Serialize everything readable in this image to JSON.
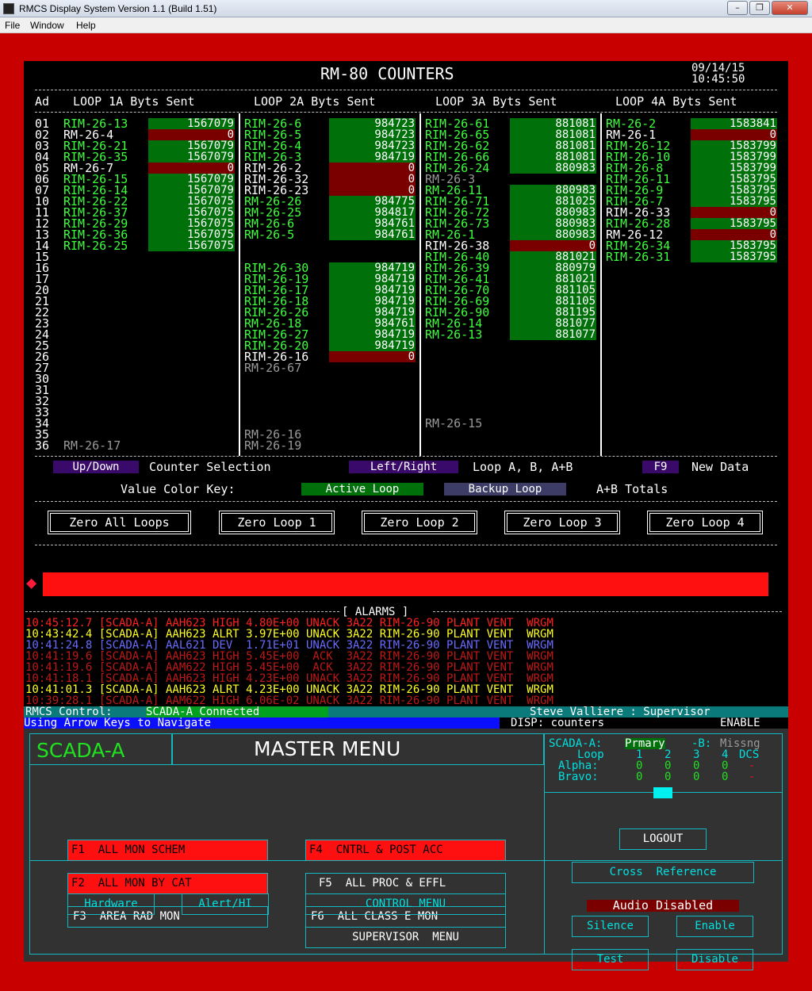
{
  "window": {
    "title": "RMCS Display System    Version 1.1    (Build 1.51)",
    "min_label": "–",
    "max_label": "❐",
    "close_label": "✕"
  },
  "menubar": {
    "items": [
      "File",
      "Window",
      "Help"
    ]
  },
  "header": {
    "title": "RM-80 COUNTERS",
    "date": "09/14/15",
    "time": "10:45:50"
  },
  "columns": {
    "addr_header": "Ad",
    "loop_headers": [
      "LOOP 1A Byts Sent",
      "LOOP 2A Byts Sent",
      "LOOP 3A Byts Sent",
      "LOOP 4A Byts Sent"
    ]
  },
  "addresses": [
    "01",
    "02",
    "03",
    "04",
    "05",
    "06",
    "07",
    "10",
    "11",
    "12",
    "13",
    "14",
    "15",
    "16",
    "17",
    "20",
    "21",
    "22",
    "23",
    "24",
    "25",
    "26",
    "27",
    "30",
    "31",
    "32",
    "33",
    "34",
    "35",
    "36"
  ],
  "loops": [
    {
      "rows": [
        {
          "name": "RIM-26-13",
          "value": "1567079",
          "status": "active"
        },
        {
          "name": "RM-26-4",
          "value": "0",
          "status": "zero"
        },
        {
          "name": "RIM-26-21",
          "value": "1567079",
          "status": "active"
        },
        {
          "name": "RIM-26-35",
          "value": "1567079",
          "status": "active"
        },
        {
          "name": "RM-26-7",
          "value": "0",
          "status": "zero"
        },
        {
          "name": "RIM-26-15",
          "value": "1567079",
          "status": "active"
        },
        {
          "name": "RIM-26-14",
          "value": "1567079",
          "status": "active"
        },
        {
          "name": "RIM-26-22",
          "value": "1567075",
          "status": "active"
        },
        {
          "name": "RIM-26-37",
          "value": "1567075",
          "status": "active"
        },
        {
          "name": "RIM-26-29",
          "value": "1567075",
          "status": "active"
        },
        {
          "name": "RIM-26-36",
          "value": "1567075",
          "status": "active"
        },
        {
          "name": "RIM-26-25",
          "value": "1567075",
          "status": "active"
        },
        null,
        null,
        null,
        null,
        null,
        null,
        null,
        null,
        null,
        null,
        null,
        null,
        null,
        null,
        null,
        null,
        null,
        {
          "name": "RM-26-17",
          "value": "",
          "status": "missing"
        }
      ]
    },
    {
      "rows": [
        {
          "name": "RIM-26-6",
          "value": "984723",
          "status": "active"
        },
        {
          "name": "RIM-26-5",
          "value": "984723",
          "status": "active"
        },
        {
          "name": "RIM-26-4",
          "value": "984723",
          "status": "active"
        },
        {
          "name": "RIM-26-3",
          "value": "984719",
          "status": "active"
        },
        {
          "name": "RIM-26-2",
          "value": "0",
          "status": "zero"
        },
        {
          "name": "RIM-26-32",
          "value": "0",
          "status": "zero"
        },
        {
          "name": "RIM-26-23",
          "value": "0",
          "status": "zero"
        },
        {
          "name": "RM-26-26",
          "value": "984775",
          "status": "active"
        },
        {
          "name": "RM-26-25",
          "value": "984817",
          "status": "active"
        },
        {
          "name": "RM-26-6",
          "value": "984761",
          "status": "active"
        },
        {
          "name": "RM-26-5",
          "value": "984761",
          "status": "active"
        },
        null,
        null,
        {
          "name": "RIM-26-30",
          "value": "984719",
          "status": "active"
        },
        {
          "name": "RIM-26-19",
          "value": "984719",
          "status": "active"
        },
        {
          "name": "RIM-26-17",
          "value": "984719",
          "status": "active"
        },
        {
          "name": "RIM-26-18",
          "value": "984719",
          "status": "active"
        },
        {
          "name": "RIM-26-26",
          "value": "984719",
          "status": "active"
        },
        {
          "name": "RM-26-18",
          "value": "984761",
          "status": "active"
        },
        {
          "name": "RIM-26-27",
          "value": "984719",
          "status": "active"
        },
        {
          "name": "RIM-26-20",
          "value": "984719",
          "status": "active"
        },
        {
          "name": "RIM-26-16",
          "value": "0",
          "status": "zero"
        },
        {
          "name": "RM-26-67",
          "value": "",
          "status": "missing"
        },
        null,
        null,
        null,
        null,
        null,
        {
          "name": "RM-26-16",
          "value": "",
          "status": "missing"
        },
        {
          "name": "RM-26-19",
          "value": "",
          "status": "missing"
        }
      ]
    },
    {
      "rows": [
        {
          "name": "RIM-26-61",
          "value": "881081",
          "status": "active"
        },
        {
          "name": "RIM-26-65",
          "value": "881081",
          "status": "active"
        },
        {
          "name": "RIM-26-62",
          "value": "881081",
          "status": "active"
        },
        {
          "name": "RIM-26-66",
          "value": "881081",
          "status": "active"
        },
        {
          "name": "RIM-26-24",
          "value": "880983",
          "status": "active"
        },
        {
          "name": "RM-26-3",
          "value": "",
          "status": "missing"
        },
        {
          "name": "RM-26-11",
          "value": "880983",
          "status": "active"
        },
        {
          "name": "RIM-26-71",
          "value": "881025",
          "status": "active"
        },
        {
          "name": "RIM-26-72",
          "value": "880983",
          "status": "active"
        },
        {
          "name": "RIM-26-73",
          "value": "880983",
          "status": "active"
        },
        {
          "name": "RM-26-1",
          "value": "880983",
          "status": "active"
        },
        {
          "name": "RIM-26-38",
          "value": "0",
          "status": "zero"
        },
        {
          "name": "RIM-26-40",
          "value": "881021",
          "status": "active"
        },
        {
          "name": "RIM-26-39",
          "value": "880979",
          "status": "active"
        },
        {
          "name": "RIM-26-41",
          "value": "881021",
          "status": "active"
        },
        {
          "name": "RIM-26-70",
          "value": "881105",
          "status": "active"
        },
        {
          "name": "RIM-26-69",
          "value": "881105",
          "status": "active"
        },
        {
          "name": "RIM-26-90",
          "value": "881195",
          "status": "active"
        },
        {
          "name": "RM-26-14",
          "value": "881077",
          "status": "active"
        },
        {
          "name": "RM-26-13",
          "value": "881077",
          "status": "active"
        },
        null,
        null,
        null,
        null,
        null,
        null,
        null,
        {
          "name": "RM-26-15",
          "value": "",
          "status": "missing"
        },
        null,
        null
      ]
    },
    {
      "rows": [
        {
          "name": "RM-26-2",
          "value": "1583841",
          "status": "active"
        },
        {
          "name": "RM-26-1",
          "value": "0",
          "status": "zero"
        },
        {
          "name": "RIM-26-12",
          "value": "1583799",
          "status": "active"
        },
        {
          "name": "RIM-26-10",
          "value": "1583799",
          "status": "active"
        },
        {
          "name": "RIM-26-8",
          "value": "1583799",
          "status": "active"
        },
        {
          "name": "RIM-26-11",
          "value": "1583795",
          "status": "active"
        },
        {
          "name": "RIM-26-9",
          "value": "1583795",
          "status": "active"
        },
        {
          "name": "RIM-26-7",
          "value": "1583795",
          "status": "active"
        },
        {
          "name": "RIM-26-33",
          "value": "0",
          "status": "zero"
        },
        {
          "name": "RIM-26-28",
          "value": "1583795",
          "status": "active"
        },
        {
          "name": "RM-26-12",
          "value": "0",
          "status": "zero"
        },
        {
          "name": "RIM-26-34",
          "value": "1583795",
          "status": "active"
        },
        {
          "name": "RIM-26-31",
          "value": "1583795",
          "status": "active"
        },
        null,
        null,
        null,
        null,
        null,
        null,
        null,
        null,
        null,
        null,
        null,
        null,
        null,
        null,
        null,
        null,
        null
      ]
    }
  ],
  "keys": {
    "updown": "Up/Down",
    "updown_desc": "Counter Selection",
    "leftright": "Left/Right",
    "leftright_desc": "Loop A, B, A+B",
    "f9": "F9",
    "f9_desc": "New Data",
    "legend_label": "Value Color Key:",
    "active": "Active Loop",
    "backup": "Backup Loop",
    "totals": "A+B Totals"
  },
  "zero_buttons": [
    "Zero All Loops",
    "Zero Loop 1",
    "Zero Loop 2",
    "Zero Loop 3",
    "Zero Loop 4"
  ],
  "latest_alarm": {
    "time": "10:45:12.7",
    "point": "AAH623",
    "value": "4.80E+00",
    "level": "HIGH"
  },
  "alarms_title": "[ ALARMS ]",
  "alarms": [
    {
      "text": "10:45:12.7 [SCADA-A] AAH623 HIGH 4.80E+00 UNACK 3A22 RIM-26-90 PLANT VENT  WRGM",
      "color": "#ff2020"
    },
    {
      "text": "10:43:42.4 [SCADA-A] AAH623 ALRT 3.97E+00 UNACK 3A22 RIM-26-90 PLANT VENT  WRGM",
      "color": "#ffff20"
    },
    {
      "text": "10:41:24.8 [SCADA-A] AAL621 DEV  1.71E+01 UNACK 3A22 RIM-26-90 PLANT VENT  WRGM",
      "color": "#6a6aff"
    },
    {
      "text": "10:41:19.6 [SCADA-A] AAH623 HIGH 5.45E+00  ACK  3A22 RIM-26-90 PLANT VENT  WRGM",
      "color": "#c01818"
    },
    {
      "text": "10:41:19.6 [SCADA-A] AAM622 HIGH 5.45E+00  ACK  3A22 RIM-26-90 PLANT VENT  WRGM",
      "color": "#c01818"
    },
    {
      "text": "10:41:18.1 [SCADA-A] AAH623 HIGH 4.23E+00 UNACK 3A22 RIM-26-90 PLANT VENT  WRGM",
      "color": "#c01818"
    },
    {
      "text": "10:41:01.3 [SCADA-A] AAH623 ALRT 4.23E+00 UNACK 3A22 RIM-26-90 PLANT VENT  WRGM",
      "color": "#ffff20"
    },
    {
      "text": "10:39:28.1 [SCADA-A] AAM622 HIGH 6.06E-02 UNACK 3A22 RIM-26-90 PLANT VENT  WRGM",
      "color": "#c01818"
    }
  ],
  "status": {
    "control_label": "RMCS Control:",
    "control_value": "SCADA-A Connected",
    "user": "Steve Valliere : Supervisor",
    "hint": "Using Arrow Keys to Navigate",
    "disp": "DISP: counters",
    "enable": "ENABLE"
  },
  "menu": {
    "system": "SCADA-A",
    "title": "MASTER MENU",
    "f_buttons": [
      {
        "label": "F1  ALL MON SCHEM",
        "style": "red"
      },
      {
        "label": "F4  CNTRL & POST ACC",
        "style": "red"
      },
      {
        "label": "F2  ALL MON BY CAT",
        "style": "red"
      },
      {
        "label": "F5  ALL PROC & EFFL",
        "style": "normal"
      },
      {
        "label": "F3  AREA RAD MON",
        "style": "normal"
      },
      {
        "label": "F6  ALL CLASS E MON",
        "style": "normal"
      }
    ],
    "hardware": "Hardware",
    "alert": "Alert/HI",
    "control": "CONTROL MENU",
    "supervisor": "SUPERVISOR  MENU",
    "scada_a_label": "SCADA-A:",
    "scada_a_status": "Prmary",
    "scada_b_label": "-B:",
    "scada_b_status": "Missng",
    "loop_label": "Loop",
    "loop_nums": [
      "1",
      "2",
      "3",
      "4"
    ],
    "dcs": "DCS",
    "alpha_label": "Alpha:",
    "bravo_label": "Bravo:",
    "alpha": [
      "0",
      "0",
      "0",
      "0"
    ],
    "bravo": [
      "0",
      "0",
      "0",
      "0"
    ],
    "dcs_alpha": "-",
    "dcs_bravo": "-",
    "logout": "LOGOUT",
    "cross_ref": "Cross  Reference",
    "audio": "Audio Disabled",
    "silence": "Silence",
    "enable": "Enable",
    "test": "Test",
    "disable": "Disable"
  },
  "colors": {
    "active_bg": "#00700a",
    "zero_bg": "#7a0000",
    "backup_bg": "#3c3c66",
    "key_purple": "#3a0a6a",
    "alarm_bar": "#ff1010",
    "menu_bg": "#323232",
    "cyan_border": "#11b8c0"
  }
}
